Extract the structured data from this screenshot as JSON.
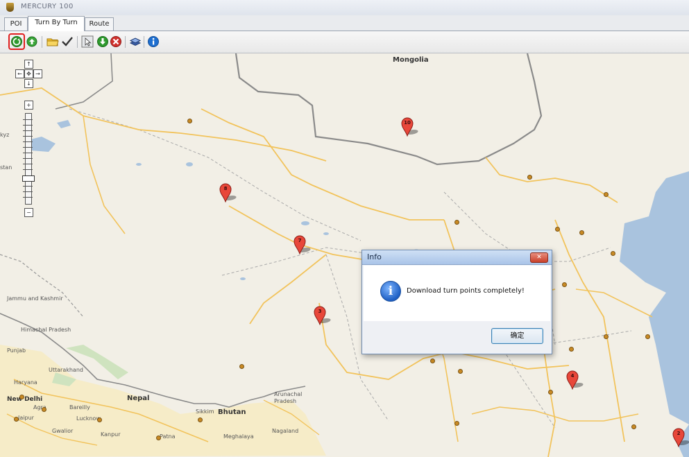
{
  "window": {
    "title": "MERCURY 100"
  },
  "tabs": [
    {
      "label": "POI"
    },
    {
      "label": "Turn By Turn"
    },
    {
      "label": "Route"
    }
  ],
  "toolbar": {
    "buttons": [
      {
        "name": "download-turn-points-icon",
        "color": "#2e9a2e"
      },
      {
        "name": "refresh-icon",
        "color": "#2e9a2e"
      },
      {
        "name": "open-folder-icon",
        "color": "#e6b422"
      },
      {
        "name": "check-icon",
        "color": "#333333"
      },
      {
        "name": "select-icon",
        "color": "#555555"
      },
      {
        "name": "download-icon",
        "color": "#2e9a2e"
      },
      {
        "name": "delete-icon",
        "color": "#d0312d"
      },
      {
        "name": "layers-icon",
        "color": "#3a5fa8"
      },
      {
        "name": "info-icon",
        "color": "#1e6fd0"
      }
    ]
  },
  "map": {
    "labels": {
      "mongolia": "Mongolia",
      "jammu_kashmir": "Jammu and Kashmir",
      "himachal": "Himachal Pradesh",
      "punjab": "Punjab",
      "uttarakhand": "Uttarakhand",
      "haryana": "Haryana",
      "new_delhi": "New Delhi",
      "nepal": "Nepal",
      "bhutan": "Bhutan",
      "sikkim": "Sikkim",
      "arunachal": "Arunachal Pradesh",
      "meghalaya": "Meghalaya",
      "nagaland": "Nagaland",
      "agra": "Agra",
      "jaipur": "Jaipur",
      "kanpur": "Kanpur",
      "lucknow": "Lucknow",
      "patna": "Patna",
      "bareilly": "Bareilly",
      "gwalior": "Gwalior",
      "pakistan_stub": "stan",
      "kyrgyz_stub": "kyz"
    },
    "markers": [
      {
        "num": "10"
      },
      {
        "num": "8"
      },
      {
        "num": "7"
      },
      {
        "num": "3"
      },
      {
        "num": "4"
      },
      {
        "num": "2"
      }
    ],
    "nav": {
      "up": "↑",
      "left": "←",
      "center": "✥",
      "right": "→",
      "down": "↓",
      "zoom_in": "+",
      "zoom_out": "−"
    }
  },
  "dialog": {
    "title": "Info",
    "close": "✕",
    "message": "Download turn points completely!",
    "ok_label": "确定"
  }
}
